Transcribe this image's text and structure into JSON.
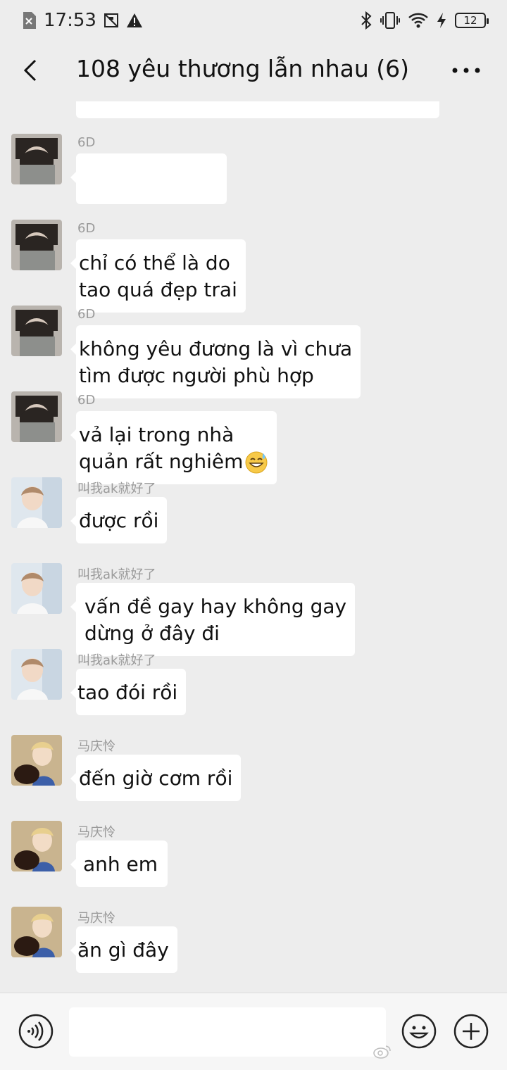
{
  "status_bar": {
    "time": "17:53",
    "battery_level": "12",
    "icons": [
      "sim-icon",
      "screenshot-icon",
      "warning-icon",
      "bluetooth-icon",
      "vibrate-icon",
      "wifi-icon",
      "charging-icon",
      "battery-icon"
    ]
  },
  "header": {
    "title": "108 yêu thương lẫn nhau (6)",
    "back_icon": "chevron-left-icon",
    "more_icon": "more-dots-icon"
  },
  "messages": [
    {
      "sender": "6D",
      "lines": []
    },
    {
      "sender": "6D",
      "lines": [
        "chỉ có thể là do",
        "tao quá đẹp trai"
      ]
    },
    {
      "sender": "6D",
      "lines": [
        "không yêu đương là vì chưa",
        "tìm được người phù hợp"
      ]
    },
    {
      "sender": "6D",
      "lines": [
        "vả lại trong nhà",
        "quản rất nghiêm"
      ],
      "emoji": "sweat-smile-emoji"
    },
    {
      "sender": "叫我ak就好了",
      "lines": [
        "được rồi"
      ]
    },
    {
      "sender": "叫我ak就好了",
      "lines": [
        "vấn đề gay hay không gay",
        "dừng ở đây đi"
      ]
    },
    {
      "sender": "叫我ak就好了",
      "lines": [
        "tao đói rồi"
      ]
    },
    {
      "sender": "马庆怜",
      "lines": [
        "đến giờ cơm rồi"
      ]
    },
    {
      "sender": "马庆怜",
      "lines": [
        "anh em"
      ]
    },
    {
      "sender": "马庆怜",
      "lines": [
        "ăn gì đây"
      ]
    }
  ],
  "input_bar": {
    "text_value": "",
    "voice_icon": "voice-icon",
    "emoji_icon": "emoji-icon",
    "plus_icon": "plus-icon"
  },
  "colors": {
    "background": "#ededed",
    "bubble": "#ffffff",
    "sender_name": "#9a9a9a"
  }
}
